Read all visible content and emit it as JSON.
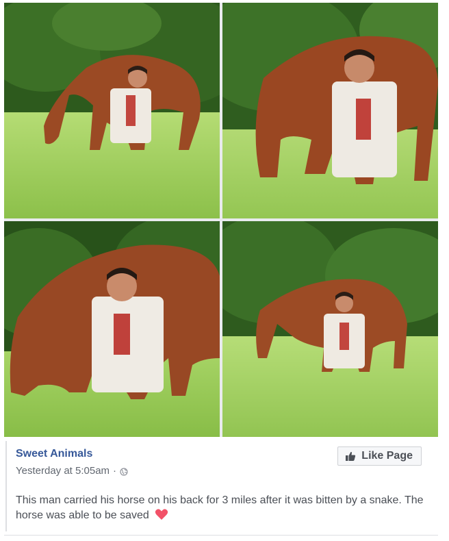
{
  "post": {
    "page_name": "Sweet Animals",
    "timestamp": "Yesterday at 5:05am",
    "separator": "·",
    "privacy_icon": "globe-icon",
    "like_button_label": "Like Page",
    "like_button_icon": "thumbs-up-icon",
    "caption": "This man carried his horse on his back for 3 miles after it was bitten by a snake. The horse was able to be saved",
    "caption_emoji": "heart-icon"
  },
  "colors": {
    "link": "#365899",
    "meta_text": "#616770",
    "body_text": "#4b4f56",
    "heart": "#f25268",
    "grass": "#9fce5a",
    "foliage": "#2f5a1e",
    "horse": "#9b4a24"
  }
}
